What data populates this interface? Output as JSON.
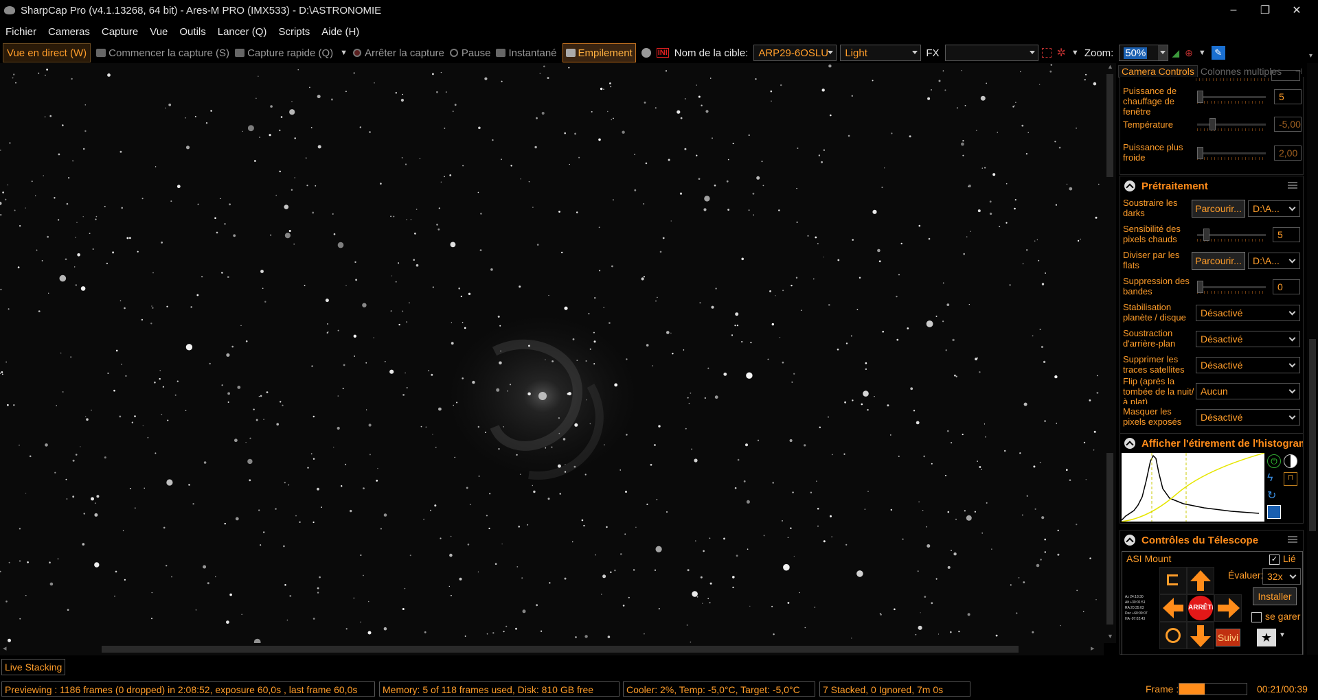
{
  "window": {
    "title": "SharpCap Pro (v4.1.13268, 64 bit) - Ares-M PRO (IMX533) - D:\\ASTRONOMIE",
    "minimize": "–",
    "maximize": "❐",
    "close": "✕"
  },
  "menu": [
    "Fichier",
    "Cameras",
    "Capture",
    "Vue",
    "Outils",
    "Lancer (Q)",
    "Scripts",
    "Aide (H)"
  ],
  "toolbar": {
    "live_view": "Vue en direct (W)",
    "start_capture": "Commencer la capture (S)",
    "quick_capture": "Capture rapide (Q)",
    "stop_capture": "Arrêter la capture",
    "pause": "Pause",
    "snapshot": "Instantané",
    "stacking": "Empilement",
    "target_label": "Nom de la cible:",
    "target_value": "ARP29-6OSLU",
    "frame_type": "Light",
    "fx_label": "FX",
    "fx_value": "",
    "zoom_label": "Zoom:",
    "zoom_value": "50%"
  },
  "panel": {
    "tab_active": "Camera Controls",
    "tab_inactive": "Colonnes multiples",
    "camera_controls": [
      {
        "label": "Puissance de chauffage de fenêtre",
        "value": "5",
        "level": 0.0
      },
      {
        "label": "Température",
        "value": "-5,00",
        "level": 0.2
      },
      {
        "label": "Puissance plus froide",
        "value": "2,00",
        "level": 0.0
      }
    ],
    "preprocessing": {
      "title": "Prétraitement",
      "subtract_darks": {
        "label": "Soustraire les darks",
        "browse": "Parcourir...",
        "path": "D:\\A..."
      },
      "hot_pixel": {
        "label": "Sensibilité des pixels chauds",
        "value": "5",
        "level": 0.1
      },
      "divide_flats": {
        "label": "Diviser par les flats",
        "browse": "Parcourir...",
        "path": "D:\\A..."
      },
      "banding": {
        "label": "Suppression des bandes",
        "value": "0",
        "level": 0.0
      },
      "stabilization": {
        "label": "Stabilisation planète / disque",
        "value": "Désactivé"
      },
      "background": {
        "label": "Soustraction d'arrière-plan",
        "value": "Désactivé"
      },
      "satellites": {
        "label": "Supprimer les traces satellites",
        "value": "Désactivé"
      },
      "flip": {
        "label": "Flip (après la tombée de la nuit/à plat)",
        "value": "Aucun"
      },
      "mask": {
        "label": "Masquer les pixels exposés",
        "value": "Désactivé"
      }
    },
    "histogram": {
      "title": "Afficher l'étirement de l'histogram"
    },
    "telescope": {
      "title": "Contrôles du Télescope",
      "mount": "ASI Mount",
      "linked_label": "Lié",
      "linked": true,
      "rate_label": "Évaluer:",
      "rate_value": "32x",
      "install_button": "Installer",
      "park_label": "se garer",
      "stop_label": "ARRÊTE",
      "track_label": "Suivi",
      "coords": [
        "Az  24:18:30",
        "Alt +30:01:51",
        "RA  20:35:03",
        "Dec +60:09:07",
        "HA  -07:02:43"
      ]
    }
  },
  "live_stacking_label": "Live Stacking",
  "status": {
    "preview": "Previewing : 1186 frames (0 dropped) in 2:08:52, exposure 60,0s , last frame 60,0s",
    "memory": "Memory: 5 of 118 frames used, Disk: 810 GB free",
    "cooler": "Cooler: 2%, Temp: -5,0°C, Target: -5,0°C",
    "stacked": "7 Stacked, 0 Ignored, 7m 0s",
    "frame_label": "Frame :",
    "frame_progress": 0.38,
    "elapsed": "00:21/00:39"
  },
  "colors": {
    "accent": "#ff9d2a",
    "background": "#000000",
    "stop": "#e21818"
  }
}
